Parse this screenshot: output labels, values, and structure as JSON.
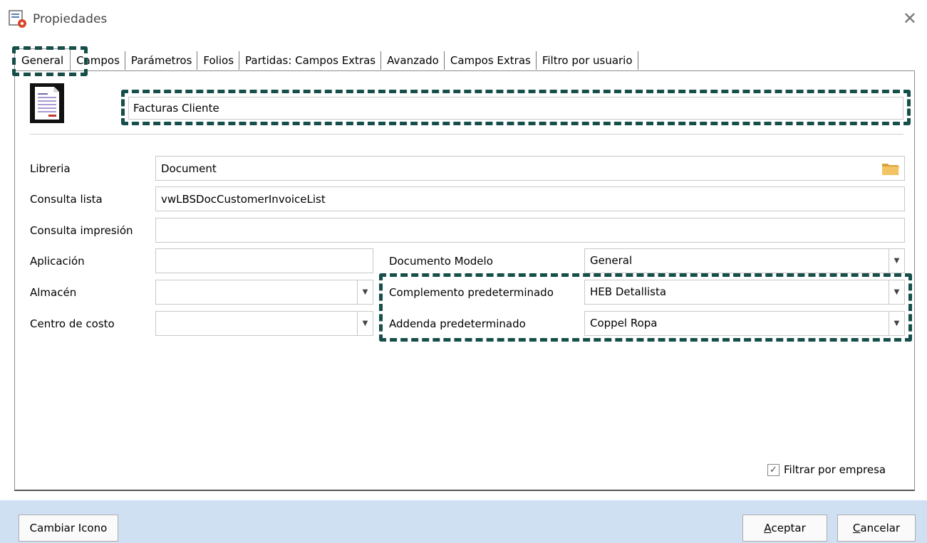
{
  "window": {
    "title": "Propiedades",
    "close_icon": "close-icon"
  },
  "tabs": [
    {
      "label": "General",
      "active": true
    },
    {
      "label": "Campos"
    },
    {
      "label": "Parámetros"
    },
    {
      "label": "Folios"
    },
    {
      "label": "Partidas: Campos Extras"
    },
    {
      "label": "Avanzado"
    },
    {
      "label": "Campos Extras"
    },
    {
      "label": "Filtro por usuario"
    }
  ],
  "general": {
    "document_icon": "invoice-document-icon",
    "name_value": "Facturas Cliente",
    "libreria_label": "Libreria",
    "libreria_value": "Document",
    "consulta_lista_label": "Consulta lista",
    "consulta_lista_value": "vwLBSDocCustomerInvoiceList",
    "consulta_impresion_label": "Consulta impresión",
    "consulta_impresion_value": "",
    "aplicacion_label": "Aplicación",
    "aplicacion_value": "",
    "almacen_label": "Almacén",
    "almacen_value": "",
    "centro_costo_label": "Centro de costo",
    "centro_costo_value": "",
    "documento_modelo_label": "Documento Modelo",
    "documento_modelo_value": "General",
    "complemento_label": "Complemento predeterminado",
    "complemento_value": "HEB Detallista",
    "addenda_label": "Addenda predeterminado",
    "addenda_value": "Coppel Ropa",
    "filtrar_label": "Filtrar por empresa",
    "filtrar_checked": true
  },
  "footer": {
    "cambiar_icono": "Cambiar Icono",
    "aceptar_first": "A",
    "aceptar_rest": "ceptar",
    "cancelar_first": "C",
    "cancelar_rest": "ancelar"
  },
  "colors": {
    "highlight_dash": "#164f4a",
    "footer_bg": "#cfe0f3"
  }
}
